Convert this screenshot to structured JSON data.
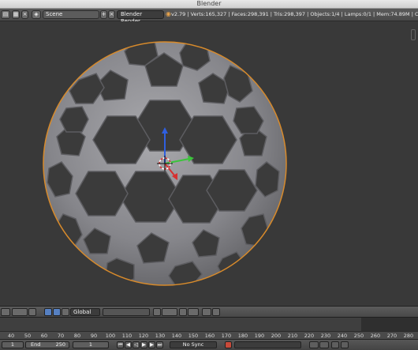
{
  "window": {
    "title": "Blender"
  },
  "info_bar": {
    "scene": "Scene",
    "render_engine": "Blender Render",
    "stats": "v2.79 | Verts:165,327 | Faces:298,391 | Tris:298,397 | Objects:1/4 | Lamps:0/1 | Mem:74.89M | ChemFTour: bes"
  },
  "viewport": {
    "object": "truncated icosahedron wireframe sphere",
    "colors": {
      "background": "#393939",
      "mesh": "#8f8f93",
      "outline": "#d78a2b"
    }
  },
  "view_header": {
    "orientation": "Global"
  },
  "timeline": {
    "ticks": [
      "40",
      "50",
      "60",
      "70",
      "80",
      "90",
      "100",
      "110",
      "120",
      "130",
      "140",
      "150",
      "160",
      "170",
      "180",
      "190",
      "200",
      "210",
      "220",
      "230",
      "240",
      "250",
      "260",
      "270",
      "280"
    ]
  },
  "footer": {
    "start_value": "1",
    "end_label": "End",
    "end_value": "250",
    "current_frame": "1",
    "sync_mode": "No Sync"
  }
}
